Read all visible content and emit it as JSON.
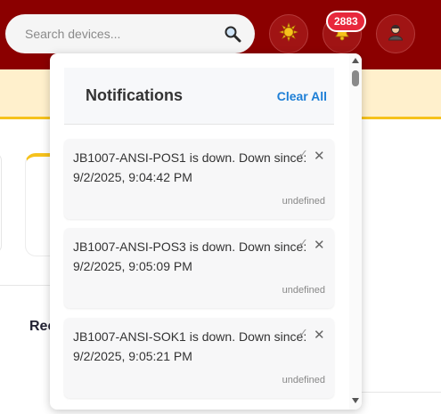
{
  "header": {
    "search_placeholder": "Search devices...",
    "notification_count": "2883",
    "accent_color": "#8b0000",
    "badge_color": "#e8283c"
  },
  "background": {
    "partial_heading": "Rec"
  },
  "notifications": {
    "title": "Notifications",
    "clear_all_label": "Clear All",
    "items": [
      {
        "message": "JB1007-ANSI-POS1 is down. Down since: 9/2/2025, 9:04:42 PM",
        "meta": "undefined"
      },
      {
        "message": "JB1007-ANSI-POS3 is down. Down since: 9/2/2025, 9:05:09 PM",
        "meta": "undefined"
      },
      {
        "message": "JB1007-ANSI-SOK1 is down. Down since: 9/2/2025, 9:05:21 PM",
        "meta": "undefined"
      }
    ]
  },
  "icons": {
    "search": "magnifier-icon",
    "theme": "sun-icon",
    "notifications": "bell-icon",
    "profile": "user-icon",
    "mark_read": "check-icon",
    "dismiss": "close-icon"
  }
}
